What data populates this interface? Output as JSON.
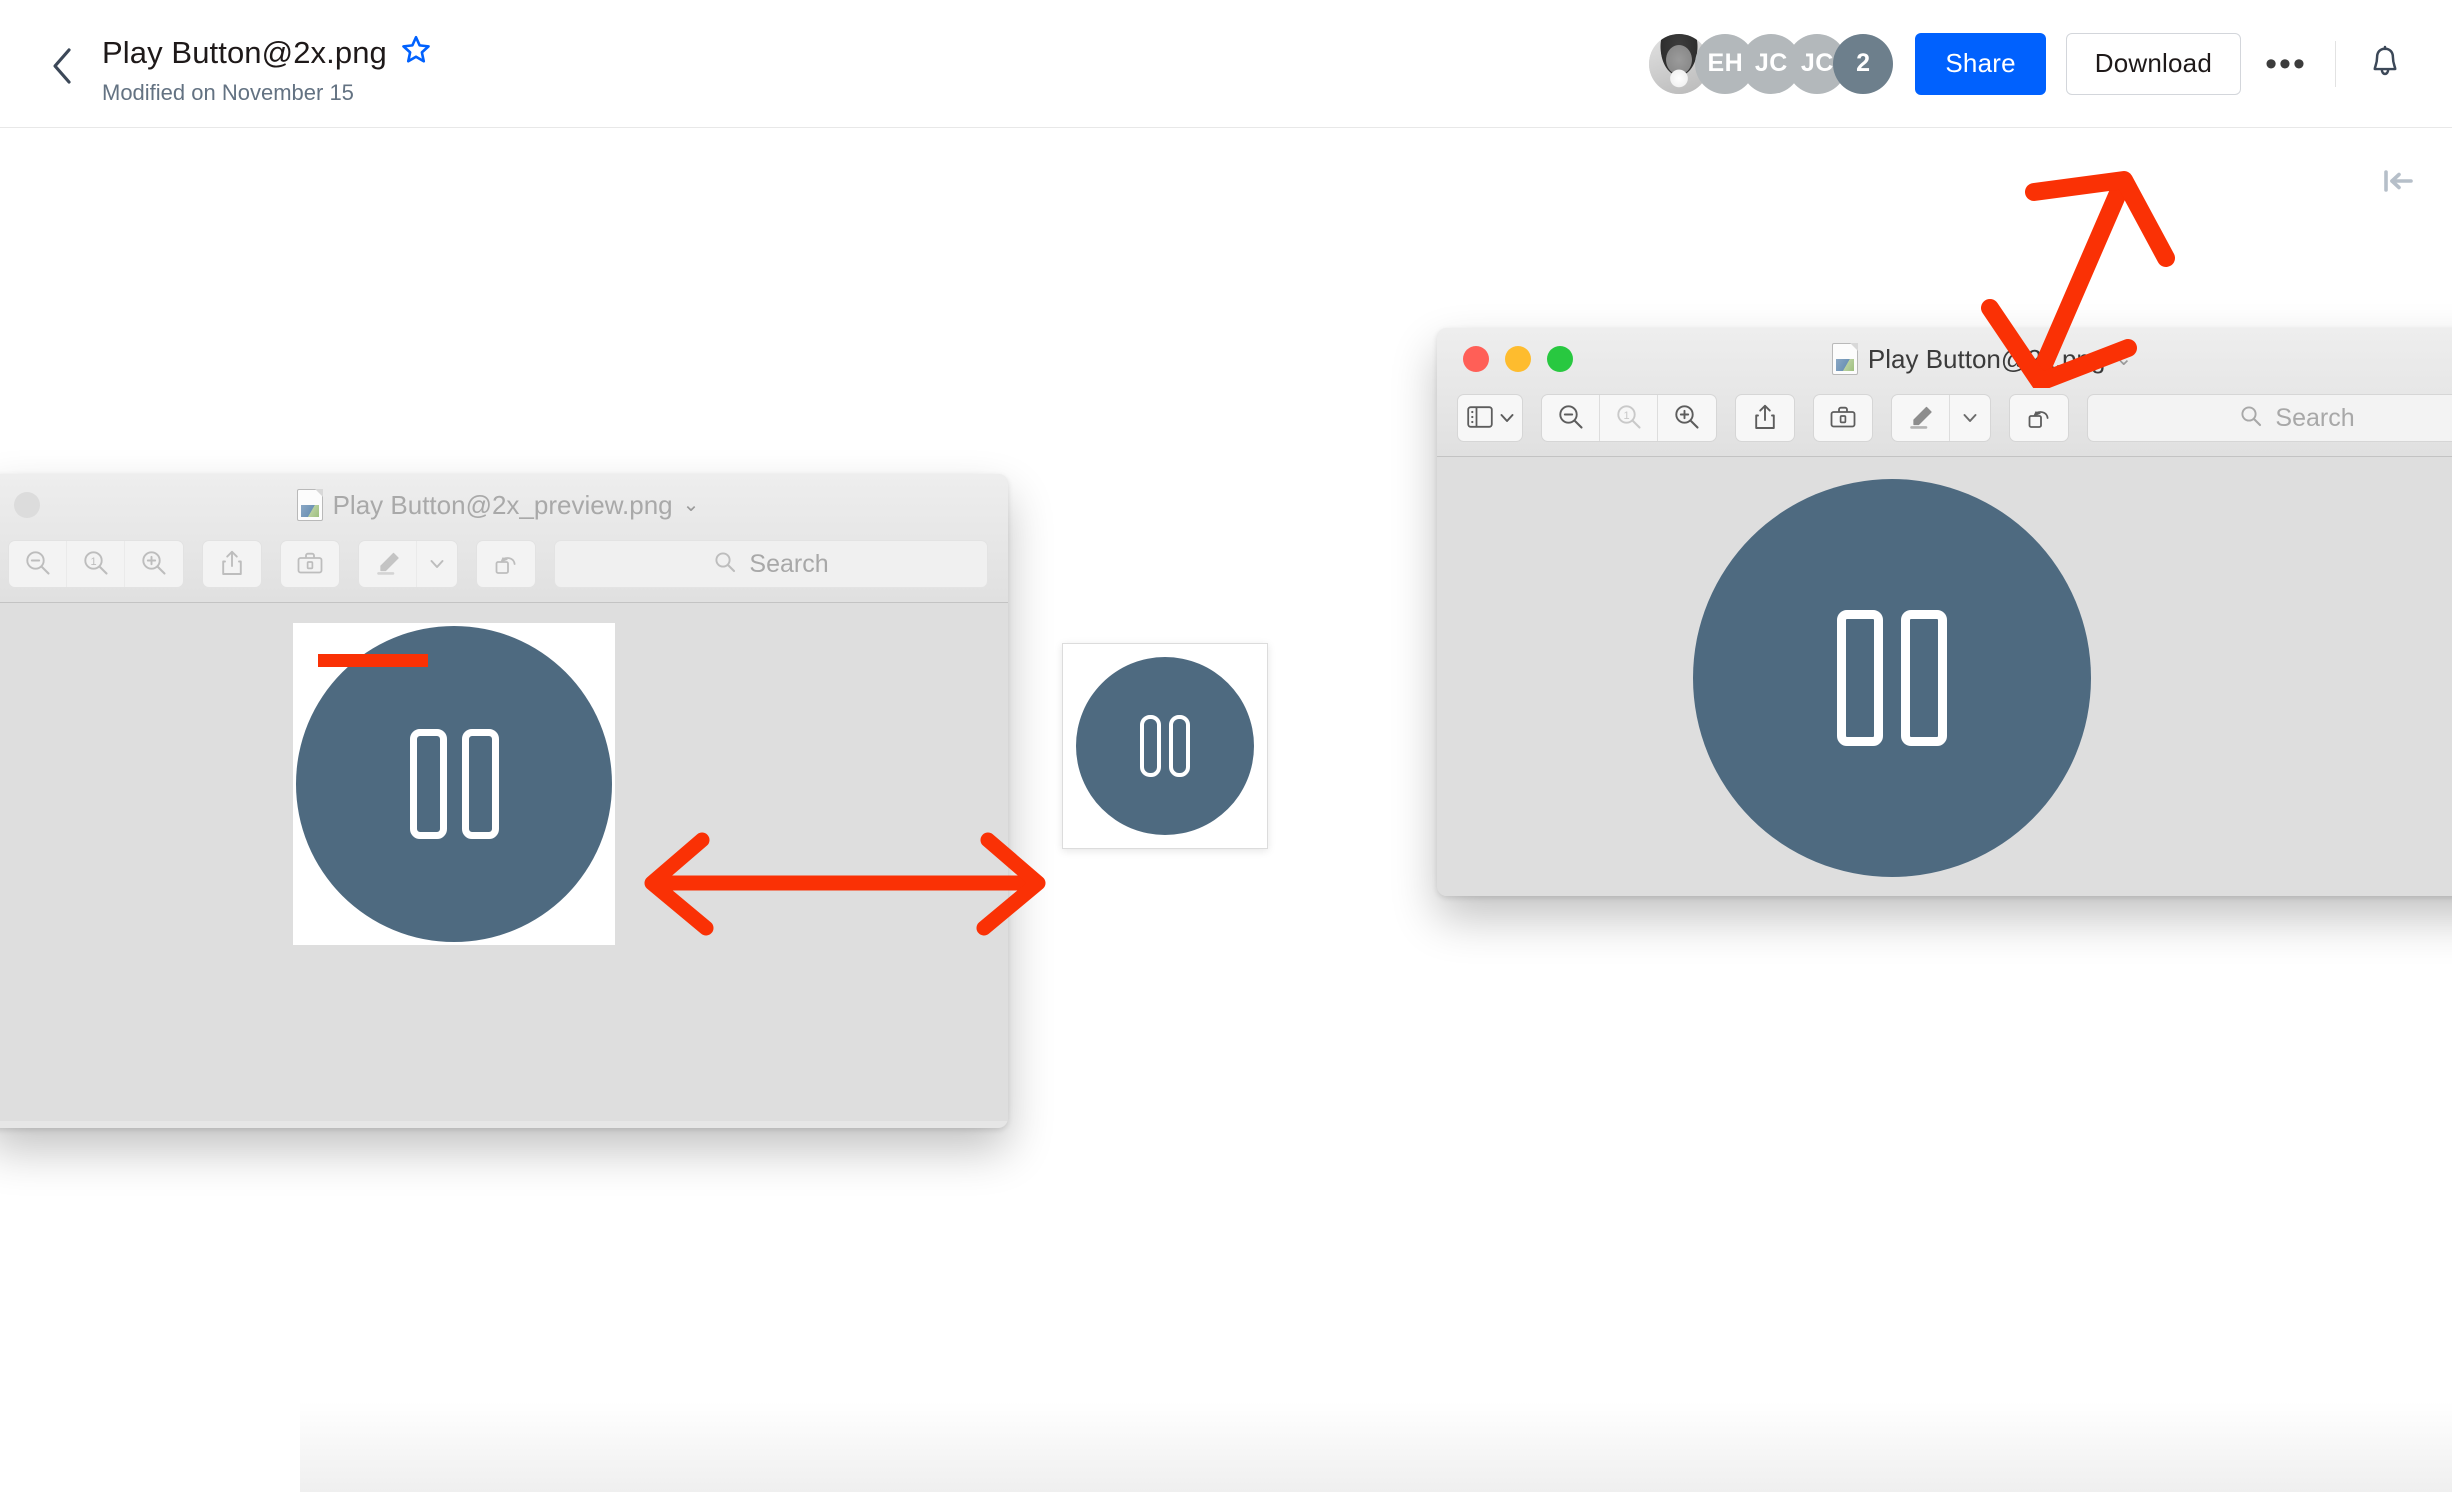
{
  "appbar": {
    "back_icon": "chevron-left-icon",
    "file_title": "Play Button@2x.png",
    "star_icon": "star-favorite-icon",
    "modified_text": "Modified on November 15",
    "avatars": [
      {
        "type": "photo",
        "label": ""
      },
      {
        "type": "initials",
        "label": "EH"
      },
      {
        "type": "initials",
        "label": "JC"
      },
      {
        "type": "initials",
        "label": "JC"
      },
      {
        "type": "count",
        "label": "2"
      }
    ],
    "share_label": "Share",
    "download_label": "Download",
    "overflow_label": "•••",
    "bell_icon": "notification-bell-icon",
    "accent_color": "#0061fe",
    "count_badge_color": "#6d7f8c"
  },
  "canvas": {
    "collapse_icon": "collapse-sidebar-icon",
    "background": "#ffffff"
  },
  "preview_window_right": {
    "title": "Play Button@2x.png",
    "title_caret": "⌄",
    "doc_icon": "image-document-icon",
    "traffic_lights": [
      "close",
      "minimize",
      "maximize"
    ],
    "toolbar": [
      {
        "name": "sidebar-toggle",
        "icon": "sidebar-panel-icon"
      },
      {
        "name": "sidebar-toggle-caret",
        "icon": "chevron-down-icon"
      },
      {
        "name": "zoom-out",
        "icon": "zoom-out-icon"
      },
      {
        "name": "zoom-actual",
        "icon": "zoom-actual-size-icon"
      },
      {
        "name": "zoom-in",
        "icon": "zoom-in-icon"
      },
      {
        "name": "share",
        "icon": "share-upload-icon"
      },
      {
        "name": "markup",
        "icon": "markup-toolbox-icon"
      },
      {
        "name": "highlight",
        "icon": "highlighter-pen-icon"
      },
      {
        "name": "highlight-caret",
        "icon": "chevron-down-icon"
      },
      {
        "name": "rotate",
        "icon": "rotate-left-icon"
      }
    ],
    "search_placeholder": "Search",
    "search_value": "",
    "body_color": "#dedede",
    "artwork": {
      "icon": "pause-button-icon",
      "disc_color": "#4e6a80",
      "bar_color": "#ffffff"
    }
  },
  "preview_window_left": {
    "title": "Play Button@2x_preview.png",
    "title_caret": "⌄",
    "doc_icon": "image-document-icon",
    "traffic_lights": [
      "close"
    ],
    "toolbar": [
      {
        "name": "zoom-out",
        "icon": "zoom-out-icon"
      },
      {
        "name": "zoom-actual",
        "icon": "zoom-actual-size-icon"
      },
      {
        "name": "zoom-in",
        "icon": "zoom-in-icon"
      },
      {
        "name": "share",
        "icon": "share-upload-icon"
      },
      {
        "name": "markup",
        "icon": "markup-toolbox-icon"
      },
      {
        "name": "highlight",
        "icon": "highlighter-pen-icon"
      },
      {
        "name": "highlight-caret",
        "icon": "chevron-down-icon"
      },
      {
        "name": "rotate",
        "icon": "rotate-left-icon"
      }
    ],
    "search_placeholder": "Search",
    "search_value": "",
    "body_color": "#dedede",
    "artwork": {
      "icon": "pause-button-icon",
      "disc_color": "#4e6a80",
      "bar_color": "#ffffff"
    }
  },
  "thumbnail_card": {
    "artwork": {
      "icon": "pause-button-icon",
      "disc_color": "#4e6a80",
      "bar_color": "#ffffff"
    }
  },
  "annotations": {
    "color": "#fa3105",
    "items": [
      {
        "name": "size-comparison-double-arrow",
        "shape": "double-headed-horizontal-arrow"
      },
      {
        "name": "download-pointer-arrow",
        "shape": "double-headed-vertical-v-arrow"
      },
      {
        "name": "filename-underline-stroke",
        "shape": "thick-horizontal-bar"
      }
    ]
  }
}
